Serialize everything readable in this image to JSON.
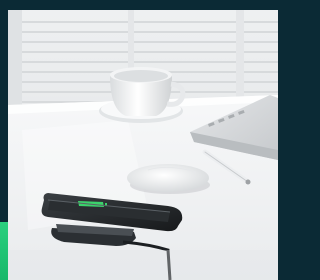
{
  "image": {
    "subject": "wireless-charging-desk-scene",
    "colors": {
      "frame": "#0b2a35",
      "accent": "#2ad07e",
      "phone_screen": "#1f2326",
      "charging_icon": "#3bd36b"
    }
  }
}
